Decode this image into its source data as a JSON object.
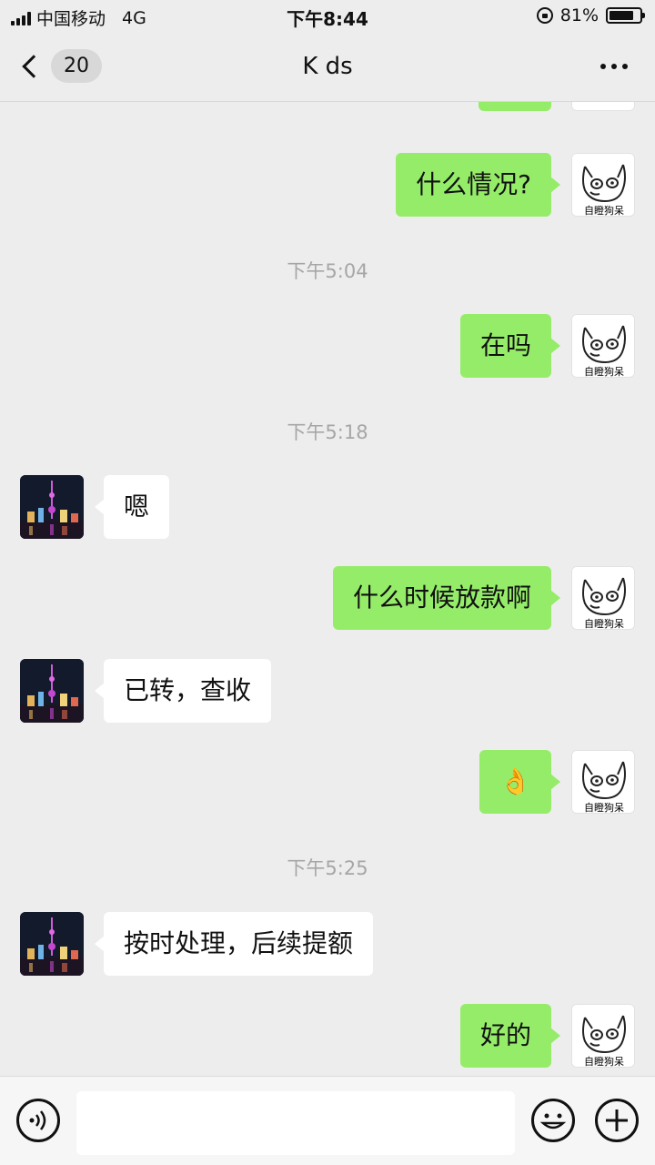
{
  "status_bar": {
    "carrier": "中国移动",
    "network": "4G",
    "time": "下午8:44",
    "battery": "81%",
    "battery_level": 0.81
  },
  "nav": {
    "unread_count": "20",
    "title": "K ds"
  },
  "messages": [
    {
      "sender": "me",
      "text": "什么情况?"
    },
    {
      "timestamp": "下午5:04"
    },
    {
      "sender": "me",
      "text": "在吗"
    },
    {
      "timestamp": "下午5:18"
    },
    {
      "sender": "other",
      "text": "嗯"
    },
    {
      "sender": "me",
      "text": "什么时候放款啊"
    },
    {
      "sender": "other",
      "text": "已转，查收"
    },
    {
      "sender": "me",
      "text": "👌"
    },
    {
      "timestamp": "下午5:25"
    },
    {
      "sender": "other",
      "text": "按时处理，后续提额"
    },
    {
      "sender": "me",
      "text": "好的"
    }
  ],
  "my_avatar_caption": "自瞪狗呆",
  "icons": {
    "voice": "voice-icon",
    "emoji": "emoji-icon",
    "add": "plus-icon",
    "back": "chevron-left-icon",
    "more": "more-icon"
  },
  "colors": {
    "my_bubble": "#95ec69",
    "other_bubble": "#ffffff",
    "background": "#ededed"
  }
}
